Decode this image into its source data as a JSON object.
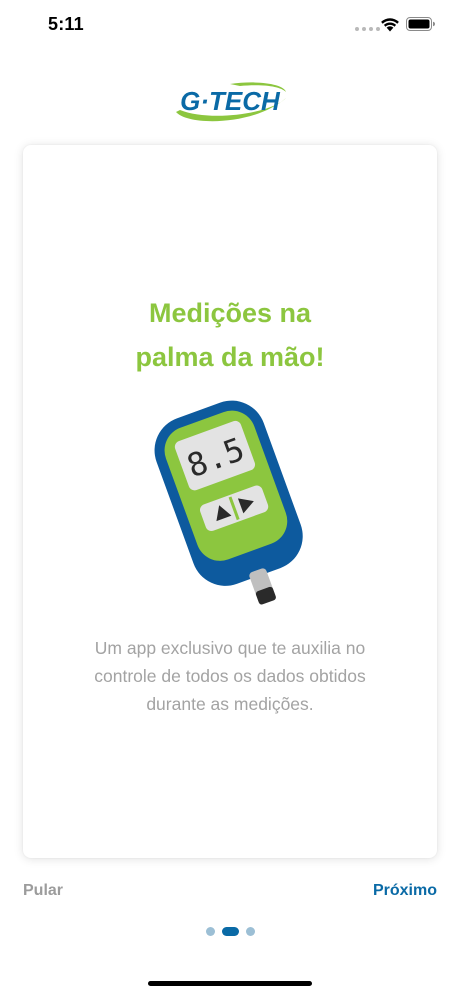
{
  "status_bar": {
    "time": "5:11",
    "icons": [
      "signal-dots-icon",
      "wifi-icon",
      "battery-icon"
    ]
  },
  "logo": {
    "text": "G·TECH",
    "colors": {
      "text": "#0a6aa6",
      "swoosh": "#8cc63f"
    }
  },
  "card": {
    "headline_lines": [
      "Medições na",
      "palma da mão!"
    ],
    "illustration": {
      "name": "glucose-meter-icon",
      "display_value": "8.5"
    },
    "description_lines": [
      "Um app exclusivo que te auxilia no",
      "controle de todos os dados obtidos",
      "durante as medições."
    ]
  },
  "navigation": {
    "skip_label": "Pular",
    "next_label": "Próximo",
    "pagination": {
      "total": 3,
      "current": 2
    }
  },
  "colors": {
    "accent_green": "#8cc63f",
    "primary_blue": "#0a6aa6",
    "text_gray": "#a3a3a3",
    "skip_gray": "#9c9c9c"
  }
}
